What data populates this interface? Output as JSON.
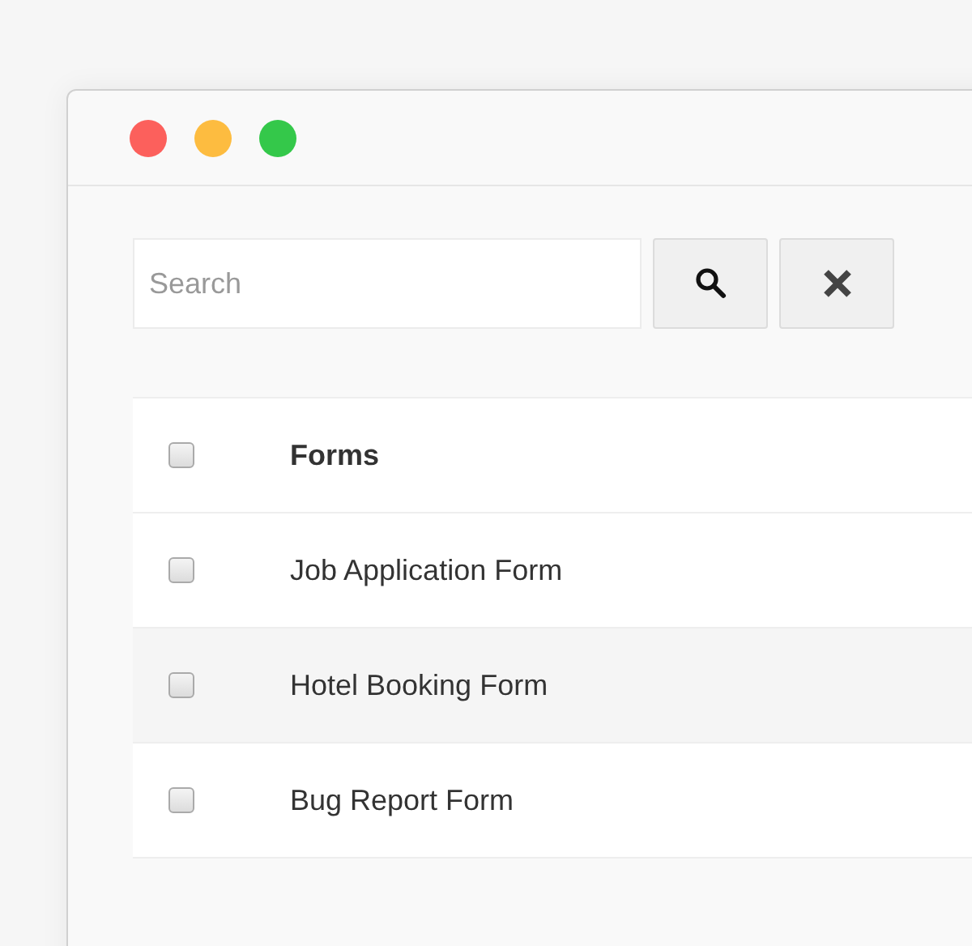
{
  "window": {
    "controls": [
      {
        "color": "#fc605c"
      },
      {
        "color": "#fdbc40"
      },
      {
        "color": "#34c84a"
      }
    ]
  },
  "search": {
    "placeholder": "Search"
  },
  "table": {
    "header": {
      "label": "Forms",
      "checked": false
    },
    "rows": [
      {
        "name": "Job Application Form",
        "checked": false
      },
      {
        "name": "Hotel Booking Form",
        "checked": false
      },
      {
        "name": "Bug Report Form",
        "checked": false
      }
    ]
  }
}
